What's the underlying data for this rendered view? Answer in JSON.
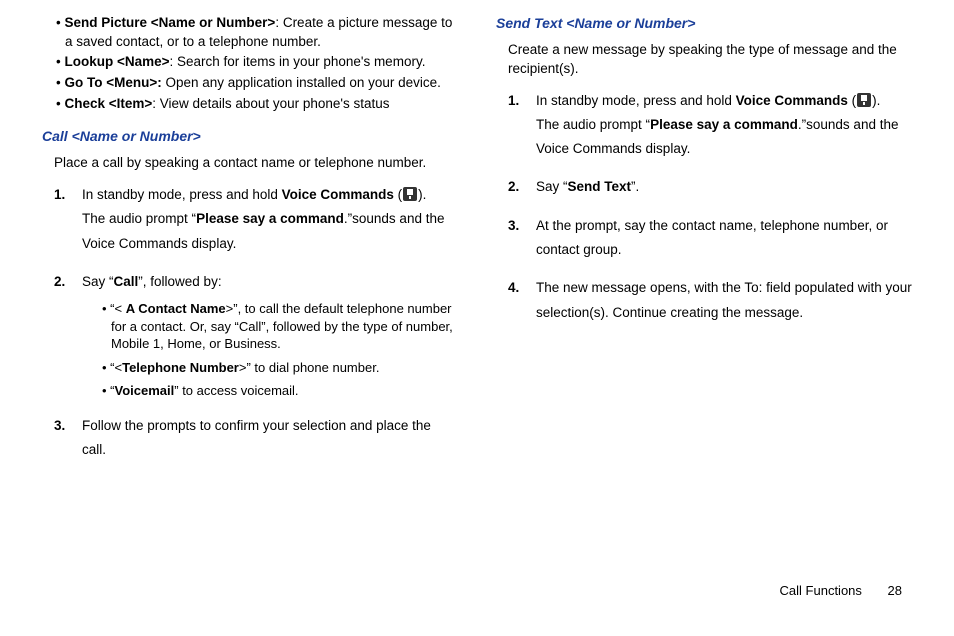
{
  "left": {
    "bullets": {
      "sendPicture": {
        "term": "Send Picture <Name or Number>",
        "desc": ": Create a picture message to a saved contact, or to a telephone number."
      },
      "lookup": {
        "term": "Lookup <Name>",
        "desc": ": Search for items in your phone's memory."
      },
      "goto": {
        "term": "Go To <Menu>:",
        "desc": " Open any application installed on your device."
      },
      "check": {
        "term": "Check <Item>",
        "desc": ": View details about your phone's status"
      }
    },
    "heading": "Call <Name or Number>",
    "lead": "Place a call by speaking a contact name or telephone number.",
    "step1": {
      "pre": "In standby mode, press and hold ",
      "vc": "Voice Commands",
      "iconOpen": " (",
      "iconClose": ").",
      "line2a": "The audio prompt “",
      "cmd": "Please say a command",
      "line2b": ".”sounds and the Voice Commands display."
    },
    "step2": {
      "pre": "Say “",
      "call": "Call",
      "post": "”, followed by:"
    },
    "sub": {
      "contact": {
        "open": "“< ",
        "term": "A Contact Name",
        "rest": ">”, to call the default telephone number for a contact.  Or, say “Call”, followed by the type of number, Mobile 1, Home, or Business."
      },
      "tel": {
        "open": "“<",
        "term": "Telephone Number",
        "rest": ">” to dial phone number."
      },
      "vm": {
        "open": "“",
        "term": "Voicemail",
        "rest": "” to access voicemail."
      }
    },
    "step3": "Follow the prompts to confirm your selection and place the call."
  },
  "right": {
    "heading": "Send Text <Name or Number>",
    "lead": "Create a new message by speaking the type of message and the recipient(s).",
    "step1": {
      "pre": "In standby mode, press and hold ",
      "vc": "Voice Commands",
      "iconOpen": " (",
      "iconClose": ").",
      "line2a": "The audio prompt “",
      "cmd": "Please say a command",
      "line2b": ".”sounds and the Voice Commands display."
    },
    "step2": {
      "pre": "Say “",
      "term": "Send Text",
      "post": "”."
    },
    "step3": "At the prompt, say the contact name, telephone number, or contact group.",
    "step4": "The new message opens, with the To: field populated with your selection(s). Continue creating the message."
  },
  "footer": {
    "section": "Call Functions",
    "page": "28"
  },
  "nums": {
    "n1": "1.",
    "n2": "2.",
    "n3": "3.",
    "n4": "4."
  }
}
